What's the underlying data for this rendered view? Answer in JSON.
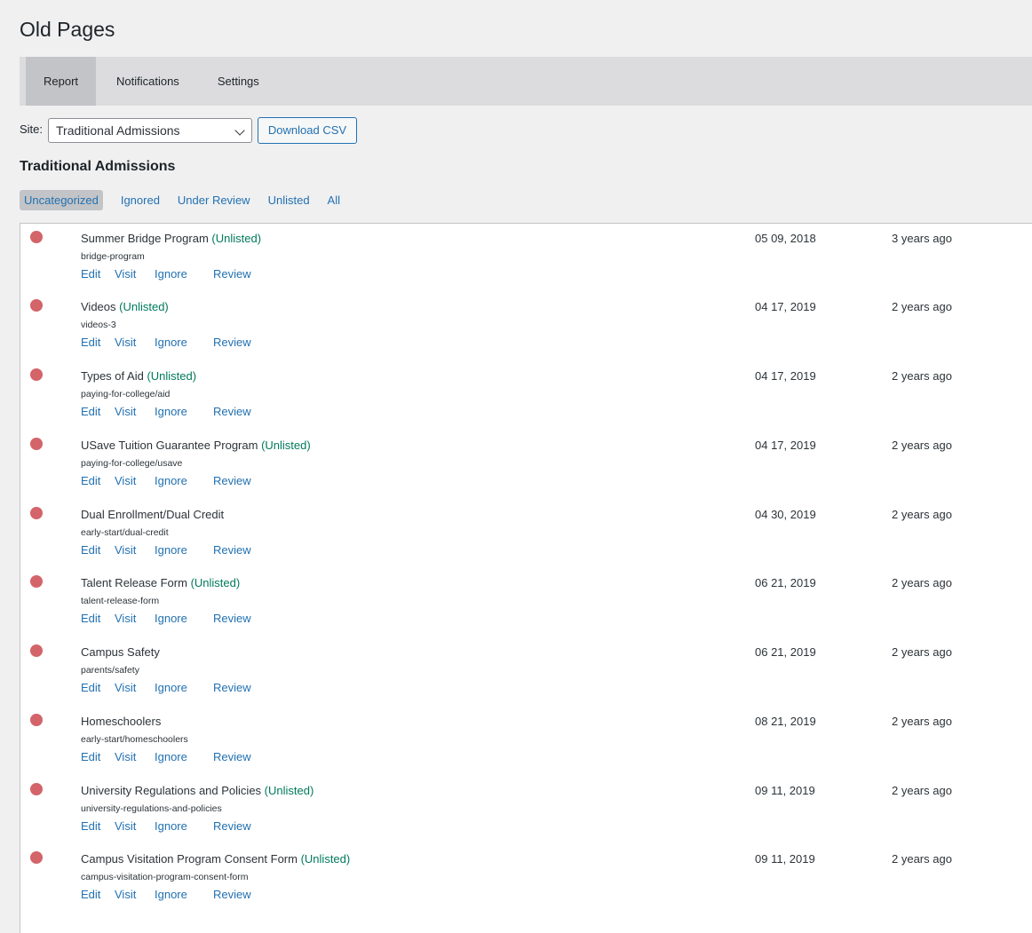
{
  "page": {
    "title": "Old Pages"
  },
  "tabs": [
    {
      "label": "Report"
    },
    {
      "label": "Notifications"
    },
    {
      "label": "Settings"
    }
  ],
  "site": {
    "label": "Site:",
    "selected": "Traditional Admissions",
    "download_label": "Download CSV"
  },
  "section": {
    "title": "Traditional Admissions"
  },
  "filters": [
    {
      "label": "Uncategorized",
      "active": true
    },
    {
      "label": "Ignored"
    },
    {
      "label": "Under Review"
    },
    {
      "label": "Unlisted"
    },
    {
      "label": "All"
    }
  ],
  "actions": {
    "edit": "Edit",
    "visit": "Visit",
    "ignore": "Ignore",
    "review": "Review"
  },
  "status_color": "#d36469",
  "rows": [
    {
      "title": "Summer Bridge Program",
      "tag": "(Unlisted)",
      "slug": "bridge-program",
      "date": "05 09, 2018",
      "ago": "3 years ago"
    },
    {
      "title": "Videos",
      "tag": "(Unlisted)",
      "slug": "videos-3",
      "date": "04 17, 2019",
      "ago": "2 years ago"
    },
    {
      "title": "Types of Aid",
      "tag": "(Unlisted)",
      "slug": "paying-for-college/aid",
      "date": "04 17, 2019",
      "ago": "2 years ago"
    },
    {
      "title": "USave Tuition Guarantee Program",
      "tag": "(Unlisted)",
      "slug": "paying-for-college/usave",
      "date": "04 17, 2019",
      "ago": "2 years ago"
    },
    {
      "title": "Dual Enrollment/Dual Credit",
      "tag": "",
      "slug": "early-start/dual-credit",
      "date": "04 30, 2019",
      "ago": "2 years ago"
    },
    {
      "title": "Talent Release Form",
      "tag": "(Unlisted)",
      "slug": "talent-release-form",
      "date": "06 21, 2019",
      "ago": "2 years ago"
    },
    {
      "title": "Campus Safety",
      "tag": "",
      "slug": "parents/safety",
      "date": "06 21, 2019",
      "ago": "2 years ago"
    },
    {
      "title": "Homeschoolers",
      "tag": "",
      "slug": "early-start/homeschoolers",
      "date": "08 21, 2019",
      "ago": "2 years ago"
    },
    {
      "title": "University Regulations and Policies",
      "tag": "(Unlisted)",
      "slug": "university-regulations-and-policies",
      "date": "09 11, 2019",
      "ago": "2 years ago"
    },
    {
      "title": "Campus Visitation Program Consent Form",
      "tag": "(Unlisted)",
      "slug": "campus-visitation-program-consent-form",
      "date": "09 11, 2019",
      "ago": "2 years ago"
    }
  ]
}
